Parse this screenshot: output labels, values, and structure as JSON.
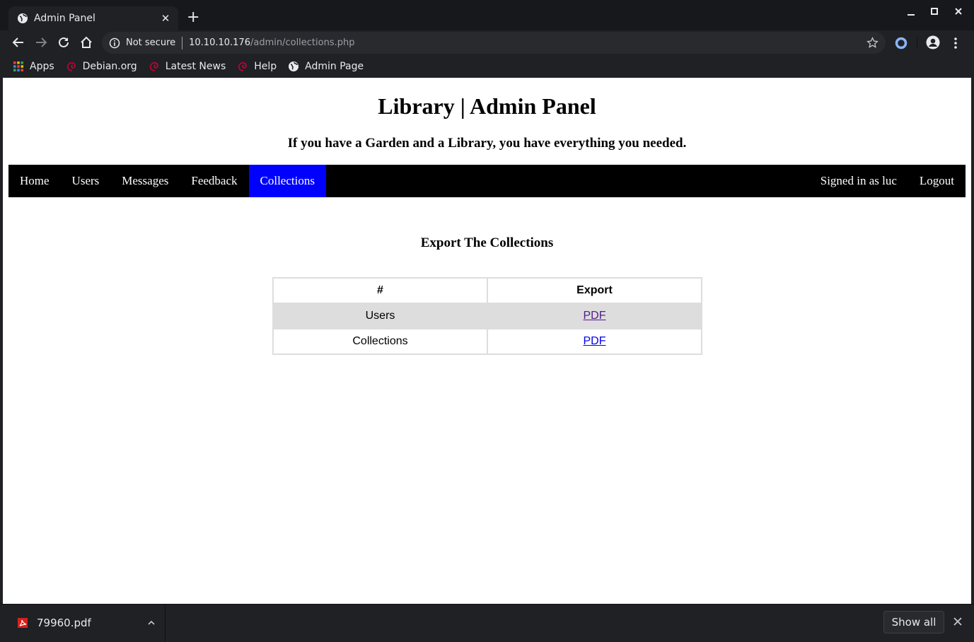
{
  "browser": {
    "tab": {
      "title": "Admin Panel",
      "icon": "globe-icon"
    },
    "window_controls": {
      "minimize": "–",
      "maximize": "□",
      "close": "✕"
    },
    "address": {
      "security_label": "Not secure",
      "host": "10.10.10.176",
      "path": "/admin/collections.php"
    },
    "bookmarks": [
      {
        "label": "Apps",
        "icon": "apps-grid-icon"
      },
      {
        "label": "Debian.org",
        "icon": "debian-icon"
      },
      {
        "label": "Latest News",
        "icon": "debian-icon"
      },
      {
        "label": "Help",
        "icon": "debian-icon"
      },
      {
        "label": "Admin Page",
        "icon": "globe-icon"
      }
    ]
  },
  "page": {
    "title": "Library | Admin Panel",
    "subtitle": "If you have a Garden and a Library, you have everything you needed.",
    "nav": {
      "items": [
        "Home",
        "Users",
        "Messages",
        "Feedback",
        "Collections"
      ],
      "active": "Collections",
      "signed_in": "Signed in as luc",
      "logout": "Logout"
    },
    "section_title": "Export The Collections",
    "table": {
      "headers": [
        "#",
        "Export"
      ],
      "rows": [
        {
          "name": "Users",
          "link": "PDF",
          "visited": true
        },
        {
          "name": "Collections",
          "link": "PDF",
          "visited": false
        }
      ]
    }
  },
  "downloads": {
    "file": "79960.pdf",
    "show_all": "Show all"
  },
  "colors": {
    "nav_active": "#0000ff",
    "link": "#0000ee",
    "link_visited": "#551a8b",
    "row_alt": "#dddddd"
  }
}
